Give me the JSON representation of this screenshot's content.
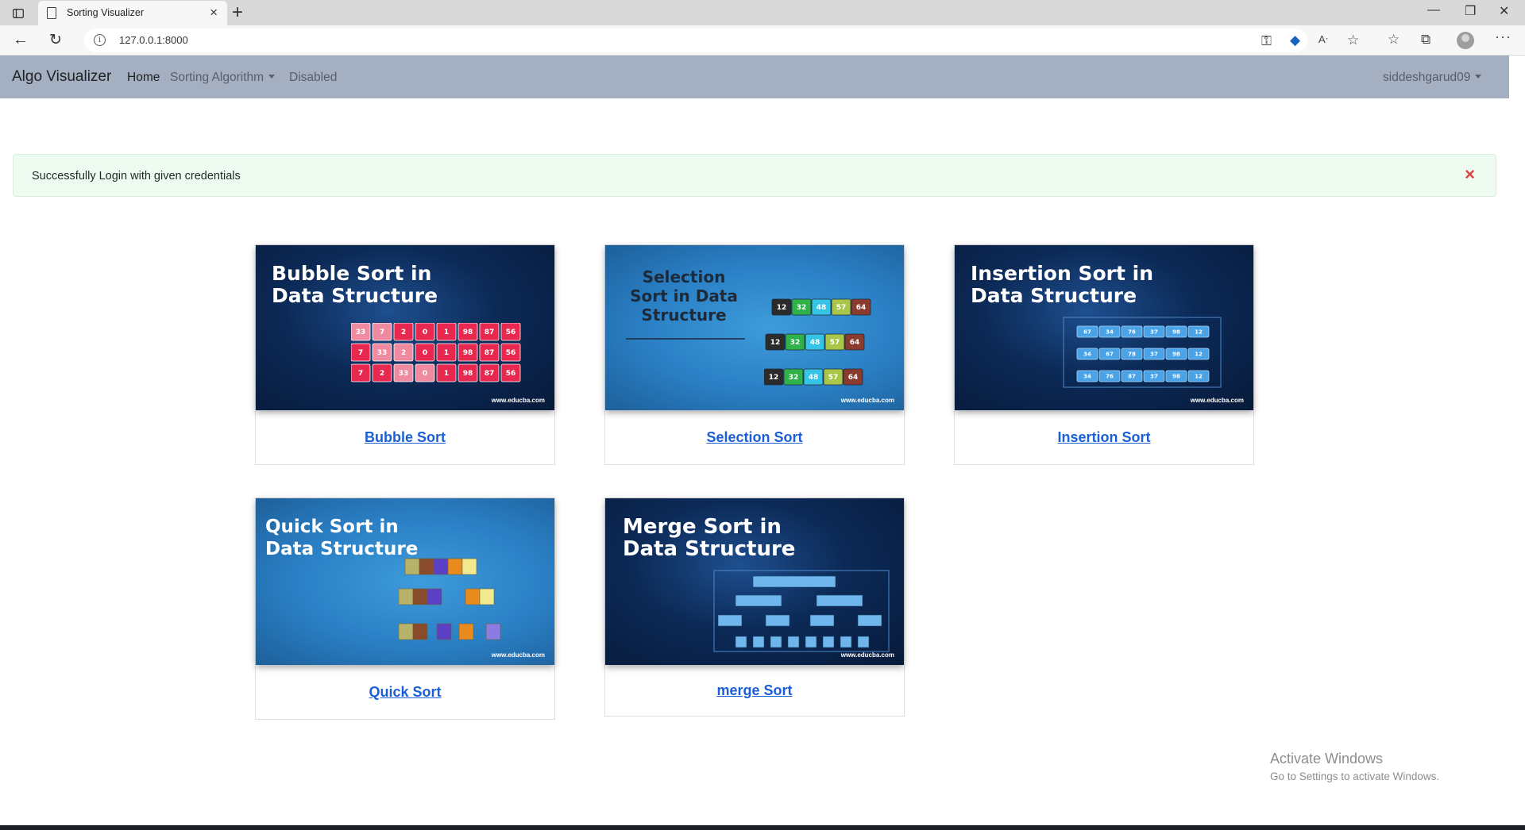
{
  "browser": {
    "tab_title": "Sorting Visualizer",
    "url": "127.0.0.1:8000"
  },
  "navbar": {
    "brand": "Algo Visualizer",
    "links": {
      "home": "Home",
      "sorting": "Sorting Algorithm",
      "disabled": "Disabled"
    },
    "user": "siddeshgarud09"
  },
  "alert": {
    "message": "Successfully Login with given credentials",
    "close_symbol": "×",
    "color": "#e04141"
  },
  "cards": [
    {
      "label": "Bubble Sort",
      "image_title": "Bubble Sort in Data Structure",
      "image_credit": "www.educba.com"
    },
    {
      "label": "Selection Sort",
      "image_title": "Selection Sort in Data Structure",
      "image_credit": "www.educba.com"
    },
    {
      "label": "Insertion Sort",
      "image_title": "Insertion Sort in Data Structure",
      "image_credit": "www.educba.com"
    },
    {
      "label": "Quick Sort",
      "image_title": "Quick Sort in Data Structure",
      "image_credit": "www.educba.com"
    },
    {
      "label": "merge Sort",
      "image_title": "Merge Sort in Data Structure",
      "image_credit": "www.educba.com"
    }
  ],
  "image_contents": {
    "bubble": {
      "rows": [
        [
          "33",
          "7",
          "2",
          "0",
          "1",
          "98",
          "87",
          "56"
        ],
        [
          "7",
          "33",
          "2",
          "0",
          "1",
          "98",
          "87",
          "56"
        ],
        [
          "7",
          "2",
          "33",
          "0",
          "1",
          "98",
          "87",
          "56"
        ]
      ]
    },
    "selection": {
      "rows": [
        [
          "12",
          "32",
          "48",
          "57",
          "64"
        ],
        [
          "12",
          "32",
          "48",
          "57",
          "64"
        ],
        [
          "12",
          "32",
          "48",
          "57",
          "64"
        ]
      ]
    },
    "insertion": {
      "rows": [
        [
          "67",
          "34",
          "76",
          "37",
          "98",
          "12"
        ],
        [
          "34",
          "67",
          "78",
          "37",
          "98",
          "12"
        ],
        [
          "34",
          "76",
          "87",
          "37",
          "98",
          "12"
        ]
      ]
    }
  },
  "watermark": {
    "line1": "Activate Windows",
    "line2": "Go to Settings to activate Windows."
  },
  "colors": {
    "navbar": "#a4b0c2",
    "link": "#1a5fd6",
    "alert_bg": "#eefbf1"
  }
}
